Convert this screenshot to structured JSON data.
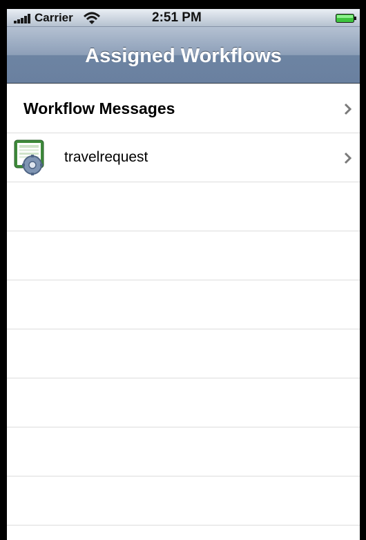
{
  "status_bar": {
    "carrier": "Carrier",
    "time": "2:51 PM",
    "signal_icon": "signal-bars-icon",
    "wifi_icon": "wifi-icon",
    "battery_icon": "battery-icon"
  },
  "nav_bar": {
    "title": "Assigned Workflows"
  },
  "list": {
    "items": [
      {
        "label": "Workflow Messages",
        "style": "bold",
        "icon": null,
        "accessory": "chevron-right-icon"
      },
      {
        "label": "travelrequest",
        "style": "normal",
        "icon": "workflow-gear-icon",
        "accessory": "chevron-right-icon"
      }
    ],
    "empty_row_count": 7
  },
  "colors": {
    "nav_bar": "#6d84a2",
    "separator": "#dcdcdc",
    "chevron": "#7a7a7a"
  }
}
